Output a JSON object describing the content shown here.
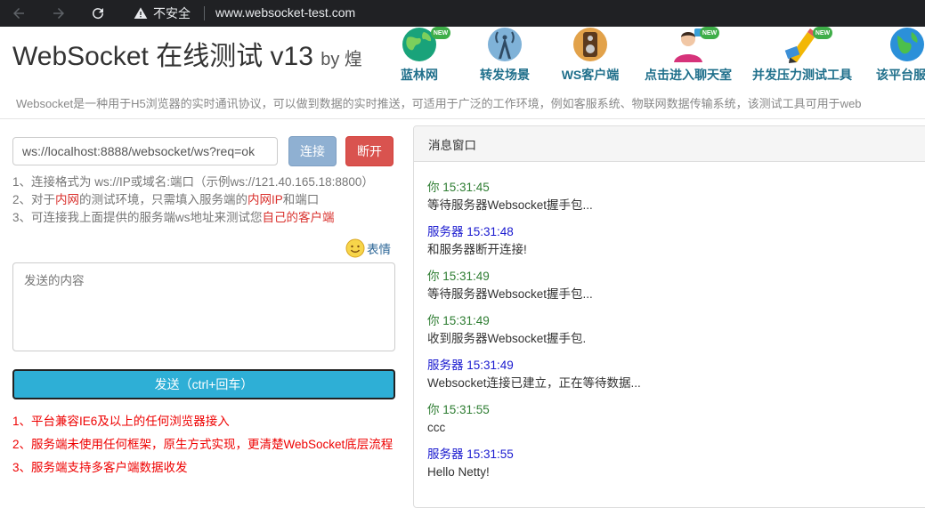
{
  "browser": {
    "security_label": "不安全",
    "url": "www.websocket-test.com"
  },
  "header": {
    "title": "WebSocket 在线测试 v13",
    "by": "by 煌",
    "new_badge": "NEW",
    "nav": [
      {
        "label": "蓝林网",
        "icon": "globe-icon",
        "new": true
      },
      {
        "label": "转发场景",
        "icon": "tower-icon",
        "new": false
      },
      {
        "label": "WS客户端",
        "icon": "speaker-icon",
        "new": false
      },
      {
        "label": "点击进入聊天室",
        "icon": "chat-user-icon",
        "new": true
      },
      {
        "label": "并发压力测试工具",
        "icon": "pencil-icon",
        "new": true
      },
      {
        "label": "该平台服务",
        "icon": "map-icon",
        "new": false
      }
    ],
    "description": "Websocket是一种用于H5浏览器的实时通讯协议，可以做到数据的实时推送，可适用于广泛的工作环境，例如客服系统、物联网数据传输系统，该测试工具可用于web"
  },
  "connection": {
    "url_value": "ws://localhost:8888/websocket/ws?req=ok",
    "connect_label": "连接",
    "disconnect_label": "断开"
  },
  "tips": {
    "line1": "1、连接格式为 ws://IP或域名:端口（示例ws://121.40.165.18:8800）",
    "line2_a": "2、对于",
    "line2_b": "内网",
    "line2_c": "的测试环境，只需填入服务端的",
    "line2_d": "内网IP",
    "line2_e": "和端口",
    "line3_a": "3、可连接我上面提供的服务端ws地址来测试您",
    "line3_b": "自己的客户端"
  },
  "emoji": {
    "label": "表情",
    "icon": "smiley-icon"
  },
  "compose": {
    "placeholder": "发送的内容",
    "send_label": "发送（ctrl+回车）"
  },
  "features": [
    "1、平台兼容IE6及以上的任何浏览器接入",
    "2、服务端未使用任何框架，原生方式实现，更清楚WebSocket底层流程",
    "3、服务端支持多客户端数据收发"
  ],
  "messages_panel": {
    "title": "消息窗口",
    "messages": [
      {
        "sender": "你",
        "time": "15:31:45",
        "text": "等待服务器Websocket握手包..."
      },
      {
        "sender": "服务器",
        "time": "15:31:48",
        "text": "和服务器断开连接!"
      },
      {
        "sender": "你",
        "time": "15:31:49",
        "text": "等待服务器Websocket握手包..."
      },
      {
        "sender": "你",
        "time": "15:31:49",
        "text": "收到服务器Websocket握手包."
      },
      {
        "sender": "服务器",
        "time": "15:31:49",
        "text": "Websocket连接已建立，正在等待数据..."
      },
      {
        "sender": "你",
        "time": "15:31:55",
        "text": "ccc"
      },
      {
        "sender": "服务器",
        "time": "15:31:55",
        "text": "Hello Netty!"
      }
    ]
  },
  "colors": {
    "you": "#2e7d32",
    "server": "#1a1acf",
    "send_button": "#2eafd6",
    "disconnect_button": "#d9534f",
    "connect_button": "#8fb0d2"
  }
}
